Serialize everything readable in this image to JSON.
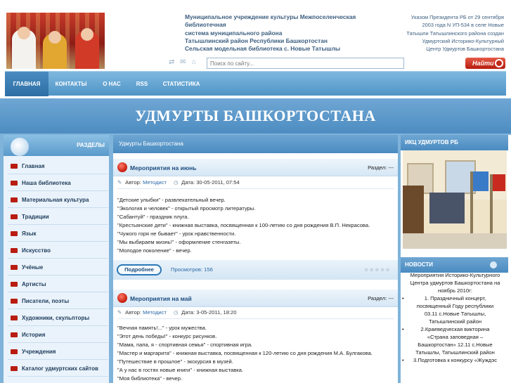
{
  "header": {
    "org_title": [
      "Муниципальное учреждение культуры Межпоселенческая библиотечная",
      "система муниципального района",
      "Татышлинский район Республики Башкортостан",
      "Сельская модельная библиотека с. Новые Татышлы"
    ],
    "decree": [
      "Указом Президента РБ от 29 сентября",
      "2003 года N УП-534 в селе Новые",
      "Татышли Татышлинского района создан",
      "Удмуртский Историко-Культурный",
      "Центр Удмуртов Башкортостана"
    ]
  },
  "search": {
    "placeholder": "Поиск по сайту...",
    "button_label": "Найти"
  },
  "nav": [
    "ГЛАВНАЯ",
    "КОНТАКТЫ",
    "О НАС",
    "RSS",
    "СТАТИСТИКА"
  ],
  "banner": {
    "title": "УДМУРТЫ БАШКОРТОСТАНА"
  },
  "sidebar": {
    "title": "РАЗДЕЛЫ",
    "items": [
      "Главная",
      "Наша библиотека",
      "Материальная культура",
      "Традиции",
      "Язык",
      "Искусство",
      "Учёные",
      "Артисты",
      "Писатели, поэты",
      "Художники, скульпторы",
      "История",
      "Учреждения",
      "Каталог удмуртских сайтов"
    ]
  },
  "breadcrumb": "Удмурты Башкортостана",
  "posts": [
    {
      "title": "Мероприятия на июнь",
      "section": "Раздел: ---",
      "author_label": "Автор:",
      "author": "Методист",
      "date": "Дата: 30-05-2011, 07:54",
      "lines": [
        "\"Детские улыбки\" - развлекательный вечер.",
        "\"Экология и человек\" - открытый просмотр литературы.",
        "\"Сабантуй\" - праздник плуга.",
        "\"Крестьянские дети\" - книжная выставка, посвященная к 100-летию со дня рождения В.П. Некрасова.",
        "\"Чужого горя не бывает\" - урок нравственности.",
        "\"Мы выбираем жизнь!\" - оформление стенгазеты.",
        "\"Молодое поколение\" - вечер."
      ],
      "more_label": "Подробнее",
      "views": "Просмотров: 156"
    },
    {
      "title": "Мероприятия на май",
      "section": "Раздел: ---",
      "author_label": "Автор:",
      "author": "Методист",
      "date": "Дата: 3-05-2011, 18:20",
      "lines": [
        "\"Вечная память!...\" - урок мужества.",
        "\"Этот день победы!\" - конкурс рисунков.",
        "\"Мама, папа, я - спортивная семья\" - спортивная игра.",
        "\"Мастер и маргарита\" - книжная выставка, посвященная к 120-летию со дня рождения М.А. Булгакова.",
        "\"Путешествие в прошлое\" - экскурсия в музей.",
        "\"А у нас в гостях новые книги\" - книжная выставка.",
        "\"Моя библиотека\" - вечер."
      ]
    }
  ],
  "right": {
    "ikc_title": "ИКЦ УДМУРТОВ РБ",
    "news_title": "НОВОСТИ",
    "news_intro": [
      "Мероприятия Историко-Культурного",
      "Центра удмуртов Башкортостана на",
      "ноябрь 2010г:"
    ],
    "news_items": [
      [
        "1. Праздничный концерт,",
        "посвященный Году республики",
        "03.11 с.Новые Татышлы,",
        "Татышлинский район"
      ],
      [
        "2.Краеведческая викторина",
        "«Страна заповедная –",
        "Башкортостан» 12.11 с.Новые",
        "Татышлы, Татышлинский район"
      ],
      [
        "3.Подготовка к конкурсу «Жуждэс"
      ]
    ]
  },
  "colors": {
    "accent_red": "#c41a0c",
    "nav_blue": "#4f94c6",
    "link_blue": "#2a69a8"
  }
}
